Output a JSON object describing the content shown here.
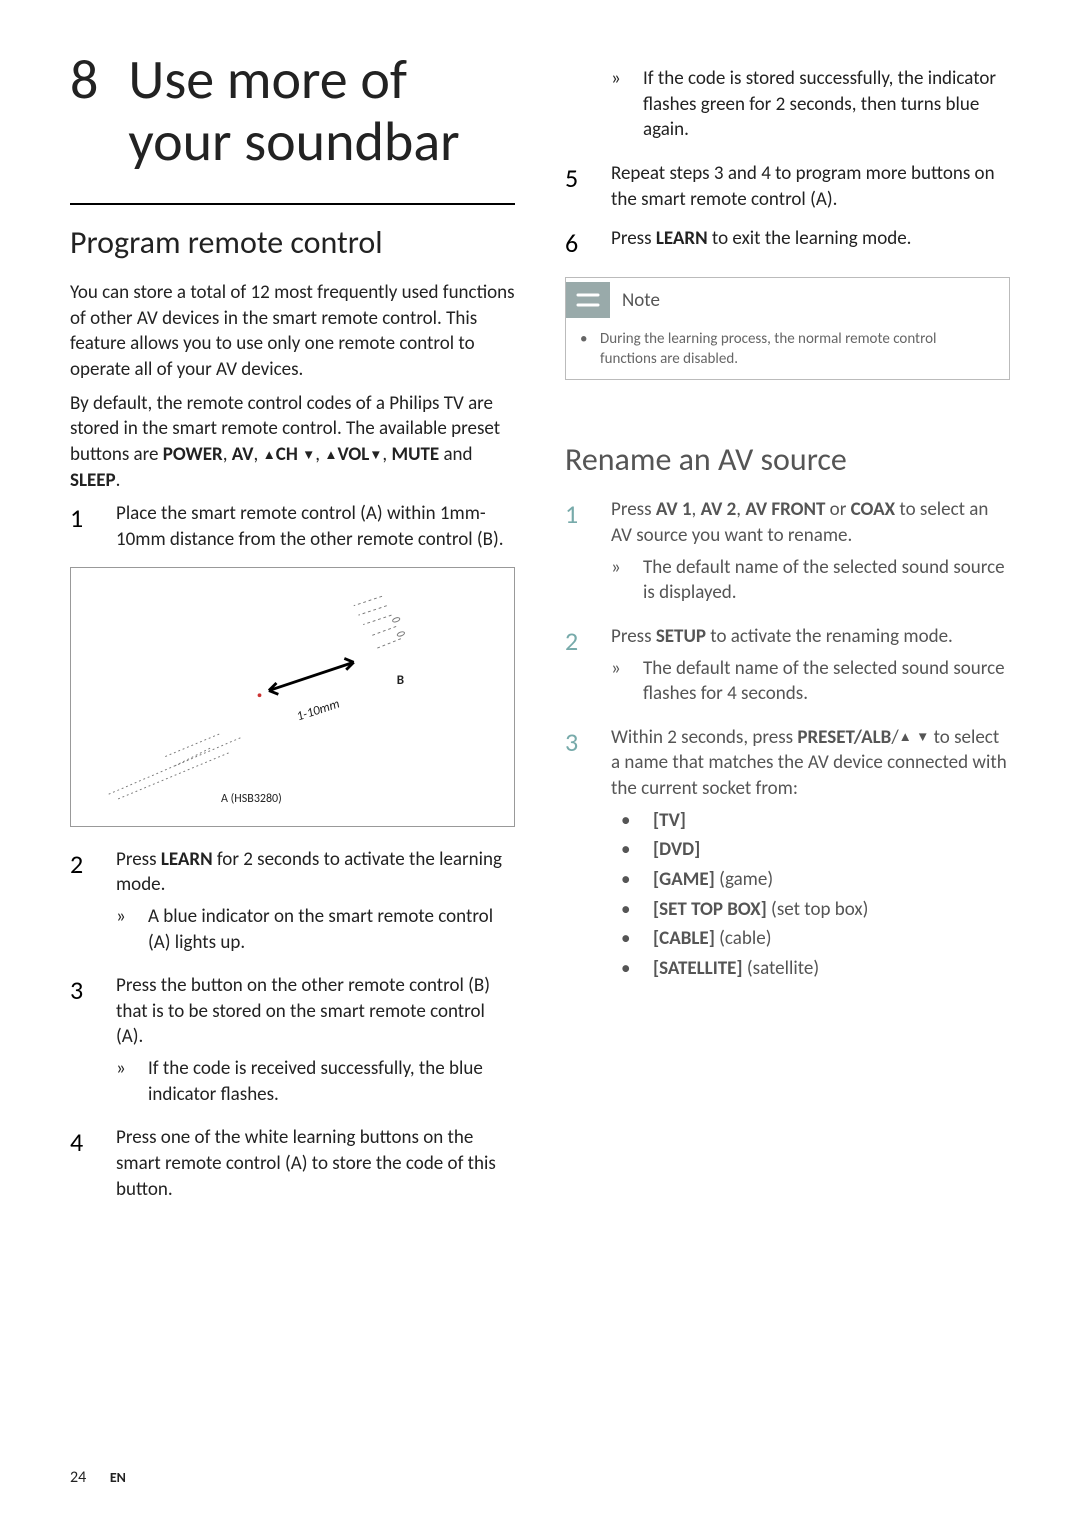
{
  "chapter": {
    "number": "8",
    "title_line1": "Use more of",
    "title_line2": "your soundbar"
  },
  "left": {
    "section_title": "Program remote control",
    "intro1": "You can store a total of 12 most frequently used functions of other AV devices in the smart remote control. This feature allows you to use only one remote control to operate all of your AV devices.",
    "intro2_a": "By default, the remote control codes of a Philips TV are stored in the smart remote control. The available preset buttons are ",
    "intro2_power": "POWER",
    "intro2_av": "AV",
    "intro2_ch": "CH",
    "intro2_vol": "VOL",
    "intro2_mute": "MUTE",
    "intro2_and": " and ",
    "intro2_sleep": "SLEEP",
    "intro2_period": ".",
    "step1": "Place the smart remote control (A) within 1mm-10mm distance from the other remote control (B).",
    "figure": {
      "label_b": "B",
      "label_a": "A (HSB3280)",
      "line": "1-10mm"
    },
    "step2_a": "Press ",
    "step2_learn": "LEARN",
    "step2_b": " for 2 seconds to activate the learning mode.",
    "step2_sub": "A blue indicator on the smart remote control (A) lights up.",
    "step3": "Press the button on the other remote control (B) that is to be stored on the smart remote control (A).",
    "step3_sub": "If the code is received successfully, the blue indicator flashes.",
    "step4": "Press one of the white learning buttons on the smart remote control (A) to store the code of this button."
  },
  "right": {
    "cont_sub": "If the code is stored successfully, the indicator flashes green for 2 seconds, then turns blue again.",
    "step5": "Repeat steps 3 and 4 to program more buttons on the smart remote control (A).",
    "step6_a": "Press ",
    "step6_learn": "LEARN",
    "step6_b": " to exit the learning mode.",
    "note_label": "Note",
    "note_body": "During the learning process, the normal remote control functions are disabled.",
    "section2_title": "Rename an AV source",
    "r_step1_a": "Press ",
    "r_av1": "AV 1",
    "r_av2": "AV 2",
    "r_avfront": "AV FRONT",
    "r_or": " or ",
    "r_coax": "COAX",
    "r_step1_b": " to select an AV source you want to rename.",
    "r_step1_sub": "The default name of the selected sound source is displayed.",
    "r_step2_a": "Press ",
    "r_setup": "SETUP",
    "r_step2_b": " to activate the renaming mode.",
    "r_step2_sub": "The default name of the selected sound source flashes for 4 seconds.",
    "r_step3_a": "Within 2 seconds, press ",
    "r_preset": "PRESET/ALB",
    "r_step3_b": " to select a name that matches the AV device connected with the current socket from:",
    "opts": {
      "tv": "[TV]",
      "dvd": "[DVD]",
      "game": "[GAME]",
      "game_p": " (game)",
      "stb": "[SET TOP BOX]",
      "stb_p": " (set top box)",
      "cable": "[CABLE]",
      "cable_p": " (cable)",
      "sat": "[SATELLITE]",
      "sat_p": " (satellite)"
    }
  },
  "footer": {
    "page": "24",
    "lang": "EN"
  }
}
